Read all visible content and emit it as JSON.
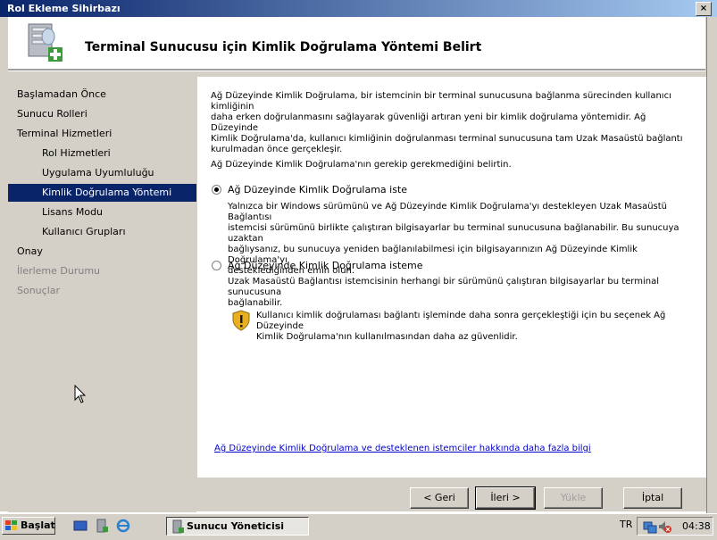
{
  "window": {
    "title": "Rol Ekleme Sihirbazı",
    "close_label": "×"
  },
  "header": {
    "title": "Terminal Sunucusu için Kimlik Doğrulama Yöntemi Belirt"
  },
  "nav": {
    "items": [
      {
        "label": "Başlamadan Önce",
        "level": 1,
        "state": "normal"
      },
      {
        "label": "Sunucu Rolleri",
        "level": 1,
        "state": "normal"
      },
      {
        "label": "Terminal Hizmetleri",
        "level": 1,
        "state": "normal"
      },
      {
        "label": "Rol Hizmetleri",
        "level": 2,
        "state": "normal"
      },
      {
        "label": "Uygulama Uyumluluğu",
        "level": 2,
        "state": "normal"
      },
      {
        "label": "Kimlik Doğrulama Yöntemi",
        "level": 2,
        "state": "selected"
      },
      {
        "label": "Lisans Modu",
        "level": 2,
        "state": "normal"
      },
      {
        "label": "Kullanıcı Grupları",
        "level": 2,
        "state": "normal"
      },
      {
        "label": "Onay",
        "level": 1,
        "state": "normal"
      },
      {
        "label": "İlerleme Durumu",
        "level": 1,
        "state": "disabled"
      },
      {
        "label": "Sonuçlar",
        "level": 1,
        "state": "disabled"
      }
    ]
  },
  "content": {
    "intro_lines": [
      "Ağ Düzeyinde Kimlik Doğrulama, bir istemcinin bir terminal sunucusuna bağlanma sürecinden kullanıcı kimliğinin",
      "daha erken doğrulanmasını sağlayarak güvenliği artıran yeni bir kimlik doğrulama yöntemidir. Ağ Düzeyinde",
      "Kimlik Doğrulama'da, kullanıcı kimliğinin doğrulanması terminal sunucusuna tam Uzak Masaüstü bağlantı",
      "kurulmadan önce gerçekleşir."
    ],
    "question": "Ağ Düzeyinde Kimlik Doğrulama'nın gerekip gerekmediğini belirtin.",
    "option1": {
      "label": "Ağ Düzeyinde Kimlik Doğrulama iste",
      "checked": true,
      "desc_lines": [
        "Yalnızca bir Windows sürümünü ve Ağ Düzeyinde Kimlik Doğrulama'yı destekleyen Uzak Masaüstü Bağlantısı",
        "istemcisi sürümünü birlikte çalıştıran bilgisayarlar bu terminal sunucusuna bağlanabilir. Bu sunucuya uzaktan",
        "bağlıysanız, bu sunucuya yeniden bağlanılabilmesi için bilgisayarınızın Ağ Düzeyinde Kimlik Doğrulama'yı",
        "desteklediğinden emin olun."
      ]
    },
    "option2": {
      "label": "Ağ Düzeyinde Kimlik Doğrulama isteme",
      "checked": false,
      "desc_lines": [
        "Uzak Masaüstü Bağlantısı istemcisinin herhangi bir sürümünü çalıştıran bilgisayarlar bu terminal sunucusuna",
        "bağlanabilir."
      ]
    },
    "warning_lines": [
      "Kullanıcı kimlik doğrulaması bağlantı işleminde daha sonra gerçekleştiği için bu seçenek Ağ Düzeyinde",
      "Kimlik Doğrulama'nın kullanılmasından daha az güvenlidir."
    ],
    "link": "Ağ Düzeyinde Kimlik Doğrulama ve desteklenen istemciler hakkında daha fazla bilgi"
  },
  "buttons": {
    "back": "< Geri",
    "next": "İleri >",
    "install": "Yükle",
    "cancel": "İptal"
  },
  "taskbar": {
    "start": "Başlat",
    "task": "Sunucu Yöneticisi",
    "lang": "TR",
    "clock": "04:38"
  }
}
